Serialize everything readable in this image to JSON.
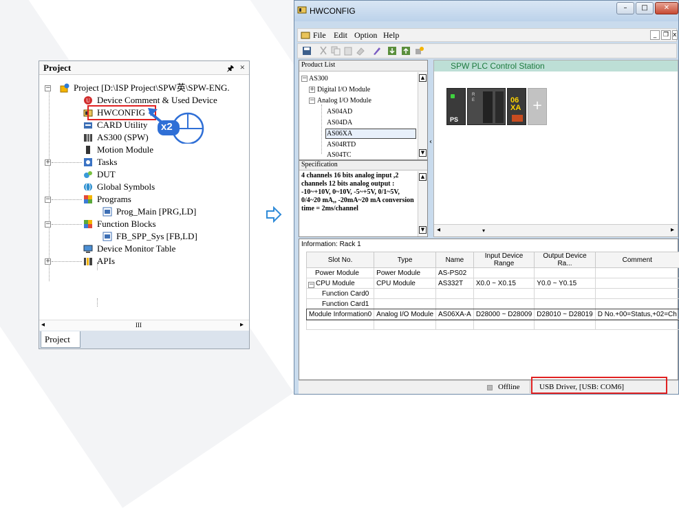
{
  "project": {
    "header": "Project",
    "pin_icon": "pin-icon",
    "close": "×",
    "items": [
      {
        "label": "Project [D:\\ISP Project\\SPW英\\SPW-ENG.",
        "icon": "project-gear-icon"
      },
      {
        "label": "Device Comment & Used Device",
        "icon": "device-comment-icon"
      },
      {
        "label": "HWCONFIG",
        "icon": "hwconfig-icon"
      },
      {
        "label": "CARD Utility",
        "icon": "card-utility-icon"
      },
      {
        "label": "AS300  (SPW)",
        "icon": "plc-icon"
      },
      {
        "label": "Motion Module",
        "icon": "motion-module-icon"
      },
      {
        "label": "Tasks",
        "icon": "tasks-icon"
      },
      {
        "label": "DUT",
        "icon": "dut-icon"
      },
      {
        "label": "Global Symbols",
        "icon": "global-symbols-icon"
      },
      {
        "label": "Programs",
        "icon": "programs-icon"
      },
      {
        "label": "Prog_Main [PRG,LD]",
        "icon": "program-item-icon"
      },
      {
        "label": "Function Blocks",
        "icon": "function-blocks-icon"
      },
      {
        "label": "FB_SPP_Sys [FB,LD]",
        "icon": "fb-item-icon"
      },
      {
        "label": "Device Monitor Table",
        "icon": "monitor-table-icon"
      },
      {
        "label": "APIs",
        "icon": "apis-icon"
      }
    ],
    "scroll_mark": "III",
    "tab": "Project",
    "double_click_hint": "x2"
  },
  "hw": {
    "title": "HWCONFIG",
    "menus": [
      "File",
      "Edit",
      "Option",
      "Help"
    ],
    "product_list": {
      "header": "Product List",
      "items": [
        "AS300",
        "Digital I/O Module",
        "Analog I/O Module",
        "AS04AD",
        "AS04DA",
        "AS06XA",
        "AS04RTD",
        "AS04TC"
      ],
      "selected": "AS06XA"
    },
    "specification": {
      "header": "Specification",
      "text": "4 channels 16 bits analog input ,2 channels 12 bits analog output : -10~+10V, 0~10V, -5~+5V, 0/1~5V, 0/4~20 mA,, -20mA~20 mA conversion time = 2ms/channel"
    },
    "station_title": "SPW PLC Control Station",
    "modules": {
      "power_label": "PS",
      "cpu_leds": [
        "R",
        "E"
      ],
      "io_label_top": "06",
      "io_label_bottom": "XA",
      "add": "+"
    },
    "info": {
      "title": "Information: Rack 1",
      "columns": [
        "Slot No.",
        "Type",
        "Name",
        "Input Device Range",
        "Output Device Ra...",
        "Comment"
      ],
      "rows": [
        [
          "Power Module",
          "Power Module",
          "AS-PS02",
          "",
          "",
          ""
        ],
        [
          "CPU Module",
          "CPU Module",
          "AS332T",
          "X0.0 ~ X0.15",
          "Y0.0 ~ Y0.15",
          ""
        ],
        [
          "Function Card0",
          "",
          "",
          "",
          "",
          ""
        ],
        [
          "Function Card1",
          "",
          "",
          "",
          "",
          ""
        ],
        [
          "Module Information0",
          "Analog I/O Module",
          "AS06XA-A",
          "D28000 ~ D28009",
          "D28010 ~ D28019",
          "D No.+00=Status,+02=Ch"
        ],
        [
          "",
          "",
          "",
          "",
          "",
          ""
        ]
      ]
    },
    "status": {
      "offline": "Offline",
      "driver": "USB Driver, [USB: COM6]"
    }
  },
  "colors": {
    "highlight": "#e02020",
    "accent": "#2f6fd6",
    "station_text": "#1d7a3e"
  }
}
